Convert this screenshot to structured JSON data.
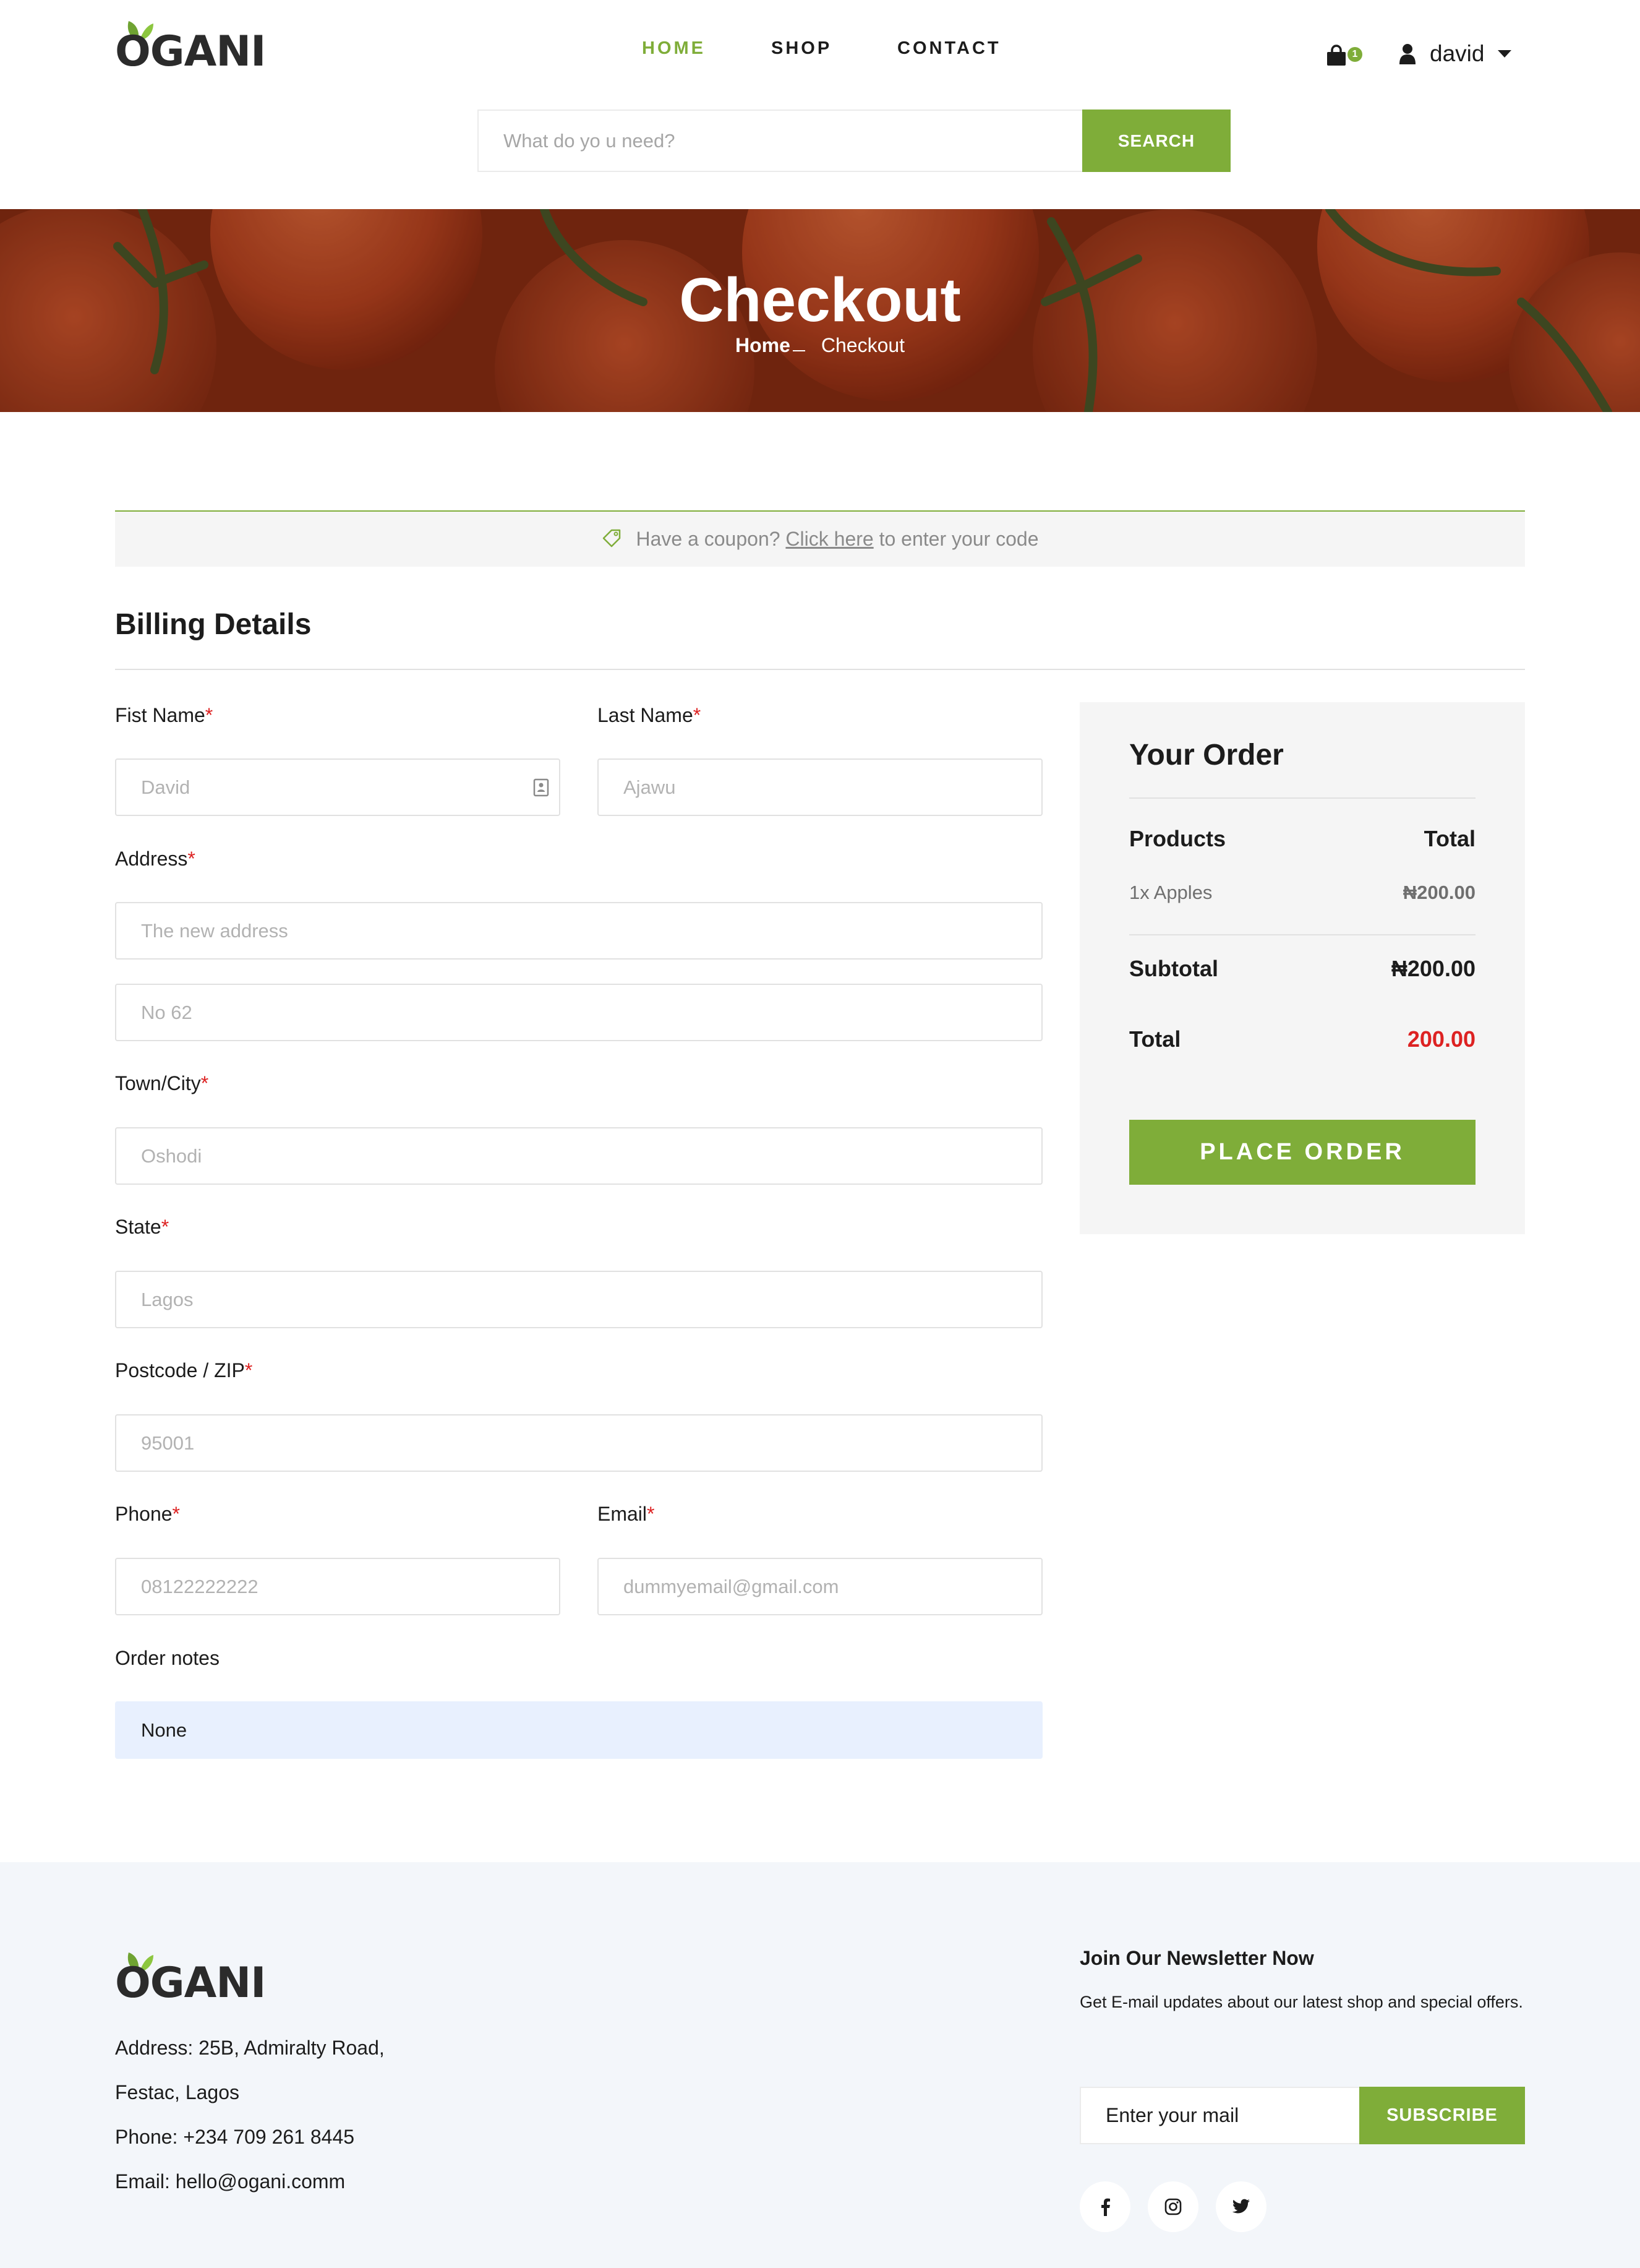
{
  "header": {
    "logo": "OGANI",
    "nav": [
      {
        "label": "HOME",
        "active": true
      },
      {
        "label": "SHOP",
        "active": false
      },
      {
        "label": "CONTACT",
        "active": false
      }
    ],
    "cart_count": "1",
    "user": {
      "name": "david",
      "icon": "user-icon"
    }
  },
  "search": {
    "placeholder": "What do yo u need?",
    "button_label": "SEARCH"
  },
  "hero": {
    "title": "Checkout",
    "breadcrumb": {
      "home": "Home",
      "current": "Checkout"
    }
  },
  "coupon": {
    "prefix": "Have a coupon?",
    "link": "Click here",
    "suffix": "to enter your code",
    "icon": "tag-icon"
  },
  "billing": {
    "title": "Billing Details",
    "required_mark": "*",
    "fields": {
      "first_name": {
        "label": "Fist Name",
        "placeholder": "David"
      },
      "last_name": {
        "label": "Last Name",
        "placeholder": "Ajawu"
      },
      "address": {
        "label": "Address",
        "placeholder": "The new address",
        "line2_placeholder": "No 62"
      },
      "city": {
        "label": "Town/City",
        "placeholder": "Oshodi"
      },
      "state": {
        "label": "State",
        "placeholder": "Lagos"
      },
      "postcode": {
        "label": "Postcode / ZIP",
        "placeholder": "95001"
      },
      "phone": {
        "label": "Phone",
        "placeholder": "08122222222"
      },
      "email": {
        "label": "Email",
        "placeholder": "dummyemail@gmail.com"
      },
      "notes": {
        "label": "Order notes",
        "value": "None"
      }
    }
  },
  "order": {
    "title": "Your Order",
    "col_products": "Products",
    "col_total": "Total",
    "items": [
      {
        "name": "1x Apples",
        "amount": "₦200.00"
      }
    ],
    "subtotal_label": "Subtotal",
    "subtotal": "₦200.00",
    "total_label": "Total",
    "total": "200.00",
    "button_label": "PLACE ORDER"
  },
  "footer": {
    "logo": "OGANI",
    "address_line1": "Address: 25B, Admiralty Road,",
    "address_line2": "Festac, Lagos",
    "phone": "Phone: +234 709 261 8445",
    "email": "Email: hello@ogani.comm",
    "newsletter": {
      "title": "Join Our Newsletter Now",
      "text": "Get E-mail updates about our latest shop and special offers.",
      "placeholder": "Enter your mail",
      "button_label": "SUBSCRIBE"
    },
    "social": [
      "facebook-icon",
      "instagram-icon",
      "twitter-icon"
    ]
  },
  "colors": {
    "accent": "#7fad39",
    "price_red": "#dd2222",
    "panel": "#f5f5f5",
    "footer_bg": "#f3f6fa"
  }
}
